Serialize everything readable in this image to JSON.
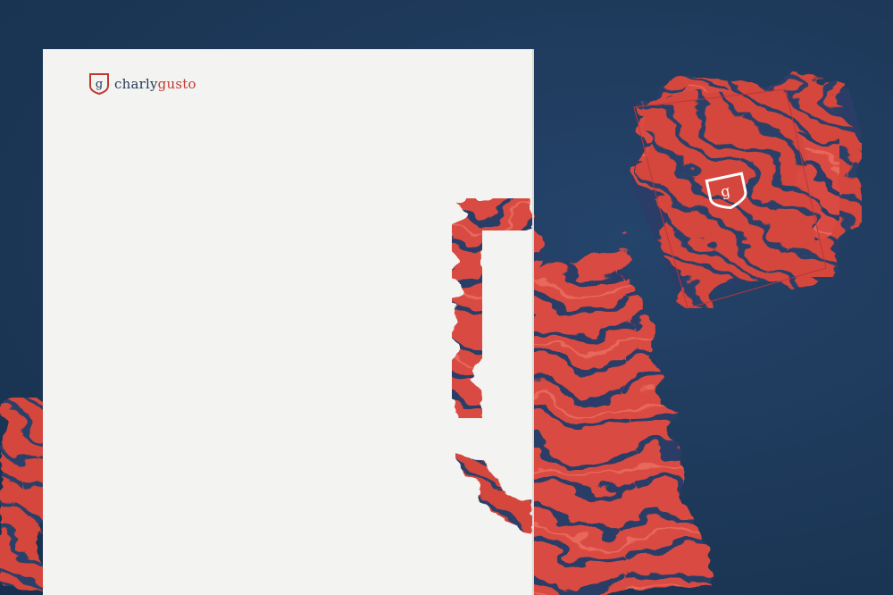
{
  "brand": {
    "name_part1": "charly",
    "name_part2": "gusto",
    "monogram": "g"
  },
  "colors": {
    "background": "#1f3a5c",
    "marble_red": "#d94b42",
    "marble_navy": "#2a3d66",
    "paper": "#f3f3f1",
    "brand_navy": "#24395b",
    "brand_red": "#c0392f"
  }
}
